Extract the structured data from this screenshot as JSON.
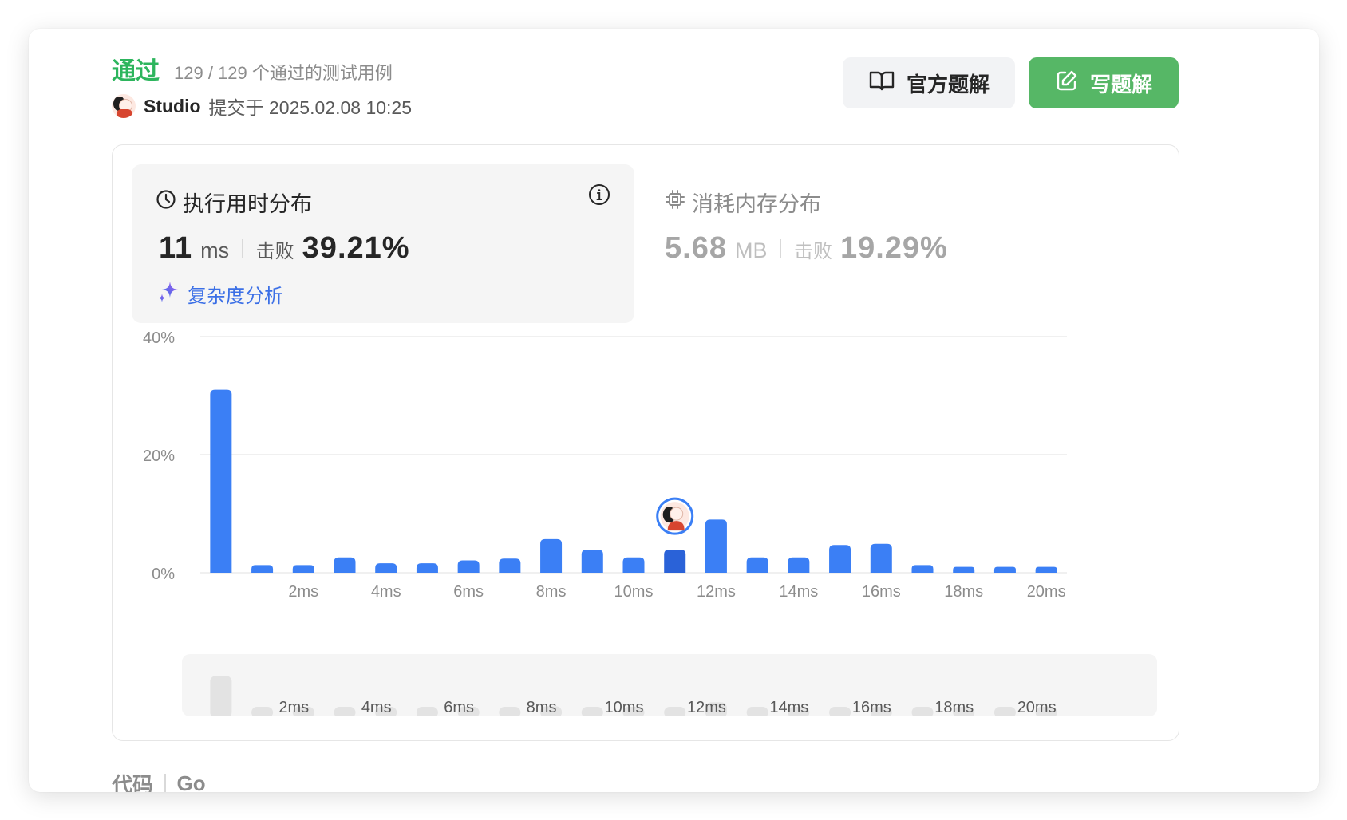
{
  "header": {
    "status": "通过",
    "cases_text": "129 / 129 个通过的测试用例",
    "username": "Studio",
    "submit_text": "提交于 2025.02.08 10:25"
  },
  "buttons": {
    "official": "官方题解",
    "write": "写题解"
  },
  "runtime": {
    "title": "执行用时分布",
    "value": "11",
    "unit": "ms",
    "beat_label": "击败",
    "beat_pct": "39.21%",
    "complexity_label": "复杂度分析"
  },
  "memory": {
    "title": "消耗内存分布",
    "value": "5.68",
    "unit": "MB",
    "beat_label": "击败",
    "beat_pct": "19.29%"
  },
  "code": {
    "label": "代码",
    "language": "Go"
  },
  "colors": {
    "accent_green": "#2db55d",
    "button_green": "#56b766",
    "bar_blue": "#3b7ff5",
    "bar_highlight": "#2a62d8",
    "link_blue": "#3b6fe6"
  },
  "chart_data": {
    "type": "bar",
    "x": [
      0,
      1,
      2,
      3,
      4,
      5,
      6,
      7,
      8,
      9,
      10,
      11,
      12,
      13,
      14,
      15,
      16,
      17,
      18,
      19,
      20
    ],
    "values": [
      31.0,
      1.3,
      1.3,
      2.6,
      1.6,
      1.6,
      2.1,
      2.4,
      5.7,
      3.9,
      2.6,
      3.9,
      9.0,
      2.6,
      2.6,
      4.7,
      4.9,
      1.3,
      1.0,
      1.0,
      1.0
    ],
    "highlight_index": 11,
    "y_ticks": [
      "0%",
      "20%",
      "40%"
    ],
    "y_tick_values": [
      0,
      20,
      40
    ],
    "x_tick_labels": [
      "2ms",
      "4ms",
      "6ms",
      "8ms",
      "10ms",
      "12ms",
      "14ms",
      "16ms",
      "18ms",
      "20ms"
    ],
    "x_tick_values": [
      2,
      4,
      6,
      8,
      10,
      12,
      14,
      16,
      18,
      20
    ],
    "ylim": [
      0,
      40
    ],
    "grid": true
  }
}
